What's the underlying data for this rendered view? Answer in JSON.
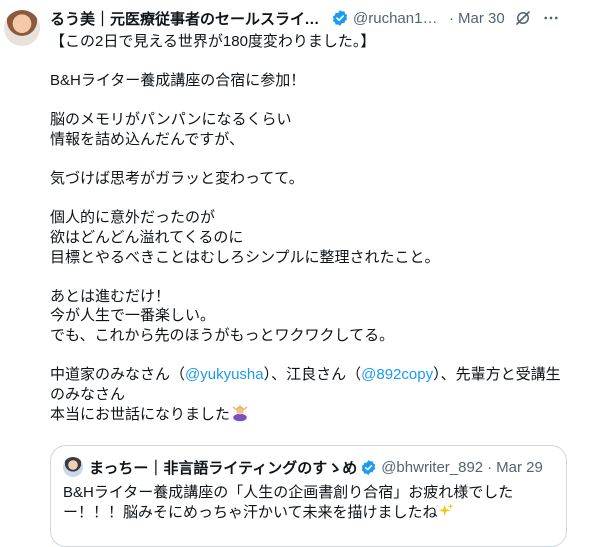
{
  "tweet": {
    "author_name": "るう美｜元医療従事者のセールスライタ…",
    "author_handle": "@ruchan16…",
    "date": "Mar 30",
    "separator": "·",
    "lines": [
      "【この2日で見える世界が180度変わりました。】",
      "",
      "B&Hライター養成講座の合宿に参加！",
      "",
      "脳のメモリがパンパンになるくらい",
      "情報を詰め込んだんですが、",
      "",
      "気づけば思考がガラッと変わってて。",
      "",
      "個人的に意外だったのが",
      "欲はどんどん溢れてくるのに",
      "目標とやるべきことはむしろシンプルに整理されたこと。",
      "",
      "あとは進むだけ！",
      "今が人生で一番楽しい。",
      "でも、これから先のほうがもっとワクワクしてる。",
      ""
    ],
    "thanks": {
      "prefix": "中道家のみなさん（",
      "mention1": "@yukyusha",
      "middle": "）、江良さん（",
      "mention2": "@892copy",
      "suffix": "）、先輩方と受講生",
      "line2": "のみなさん",
      "line3": "本当にお世話になりました"
    }
  },
  "quote": {
    "author_name": "まっちー｜非言語ライティングのすゝめ",
    "author_handle": "@bhwriter_892",
    "date": "Mar 29",
    "separator": "·",
    "line1": "B&Hライター養成講座の「人生の企画書創り合宿」お疲れ様でした",
    "line2": "ー！！！脳みそにめっちゃ汗かいて未来を描けましたね"
  },
  "icons": [
    "verified-badge-icon",
    "grok-icon",
    "more-icon",
    "bowing-person-emoji",
    "sparkles-emoji"
  ],
  "colors": {
    "text": "#0f1419",
    "muted": "#536471",
    "link": "#1d9bf0",
    "border": "#cfd9de",
    "verified": "#1d9bf0"
  }
}
